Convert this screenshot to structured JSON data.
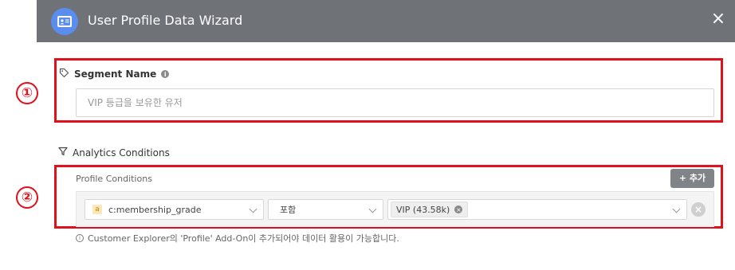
{
  "header": {
    "title": "User Profile Data Wizard",
    "close_label": "×",
    "icon": "id-card-icon",
    "background": "#6f7277",
    "logo_color": "#5b8def"
  },
  "markers": {
    "one": "①",
    "two": "②",
    "color": "#e0111b"
  },
  "segment": {
    "label": "Segment Name",
    "info_glyph": "i",
    "placeholder": "VIP 등급을 보유한 유저"
  },
  "analytics": {
    "label": "Analytics Conditions",
    "profile_label": "Profile Conditions",
    "add_button": "+ 추가",
    "condition": {
      "type_badge": "a",
      "field": "c:membership_grade",
      "operator": "포함",
      "values": [
        {
          "label": "VIP (43.58k)"
        }
      ]
    },
    "note": "Customer Explorer의 'Profile' Add-On이 추가되어야 데이터 활용이 가능합니다.",
    "note_glyph": "i"
  }
}
